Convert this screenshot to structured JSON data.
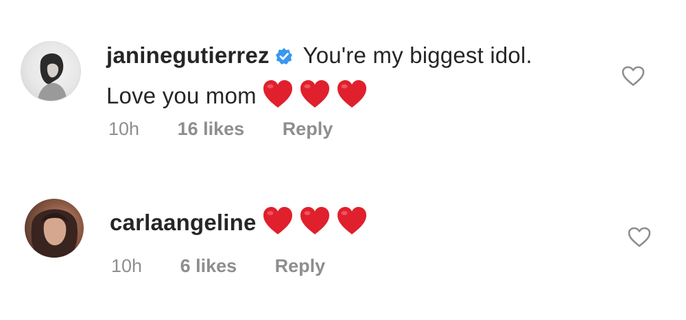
{
  "comments": [
    {
      "username": "janinegutierrez",
      "verified": true,
      "text": "You're my biggest idol. Love you mom",
      "hearts": [
        "red-heart-emoji",
        "red-heart-emoji",
        "red-heart-emoji"
      ],
      "time": "10h",
      "likes": "16 likes",
      "reply": "Reply"
    },
    {
      "username": "carlaangeline",
      "verified": false,
      "text": "",
      "hearts": [
        "red-heart-emoji",
        "red-heart-emoji",
        "red-heart-emoji"
      ],
      "time": "10h",
      "likes": "6 likes",
      "reply": "Reply"
    }
  ],
  "icons": {
    "like": "heart-outline-icon",
    "verified": "verified-badge-icon"
  },
  "colors": {
    "text": "#262626",
    "meta": "#8e8e8e",
    "verified": "#3897f0",
    "heart_emoji": "#e0202c"
  }
}
